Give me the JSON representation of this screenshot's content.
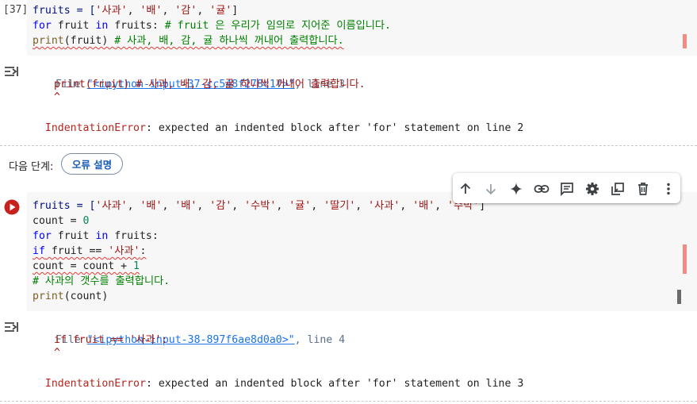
{
  "cell1": {
    "exec_count": "[37]",
    "code": [
      [
        [
          "fruits = [",
          "var"
        ],
        [
          "'사과'",
          "str"
        ],
        [
          ", ",
          ""
        ],
        [
          "'배'",
          "str"
        ],
        [
          ", ",
          ""
        ],
        [
          "'감'",
          "str"
        ],
        [
          ", ",
          ""
        ],
        [
          "'귤'",
          "str"
        ],
        [
          "]",
          ""
        ]
      ],
      [
        [
          "for",
          "kw"
        ],
        [
          " fruit ",
          ""
        ],
        [
          "in",
          "kw"
        ],
        [
          " fruits: ",
          ""
        ],
        [
          "# fruit 은 우리가 임의로 지어준 이름입니다.",
          "cm"
        ]
      ],
      [
        [
          "print",
          "fn"
        ],
        [
          "(fruit) ",
          ""
        ],
        [
          "# 사과, 배, 감, 귤 하나씩 꺼내어 출력합니다.",
          "cm"
        ]
      ]
    ],
    "output": {
      "file_prefix": "File ",
      "file_link": "\"<ipython-input-37-cc548f278c1f>\"",
      "line_info": ", line 3",
      "source_line": "print(fruit) # 사과, 배, 감, 귤 하나씩 꺼내어 출력합니다.",
      "caret": "^",
      "error_name": "IndentationError",
      "error_msg": ": expected an indented block after 'for' statement on line 2"
    }
  },
  "next_step": {
    "label": "다음 단계:",
    "button": "오류 설명"
  },
  "cell2": {
    "code": [
      [
        [
          "fruits = [",
          "var"
        ],
        [
          "'사과'",
          "str"
        ],
        [
          ", ",
          ""
        ],
        [
          "'배'",
          "str"
        ],
        [
          ", ",
          ""
        ],
        [
          "'배'",
          "str"
        ],
        [
          ", ",
          ""
        ],
        [
          "'감'",
          "str"
        ],
        [
          ", ",
          ""
        ],
        [
          "'수박'",
          "str"
        ],
        [
          ", ",
          ""
        ],
        [
          "'귤'",
          "str"
        ],
        [
          ", ",
          ""
        ],
        [
          "'딸기'",
          "str"
        ],
        [
          ", ",
          ""
        ],
        [
          "'사과'",
          "str"
        ],
        [
          ", ",
          ""
        ],
        [
          "'배'",
          "str"
        ],
        [
          ", ",
          ""
        ],
        [
          "'수박'",
          "str"
        ],
        [
          "]",
          ""
        ]
      ],
      [
        [
          "count = ",
          ""
        ],
        [
          "0",
          "num"
        ]
      ],
      [
        [
          "for",
          "kw"
        ],
        [
          " fruit ",
          ""
        ],
        [
          "in",
          "kw"
        ],
        [
          " fruits:",
          ""
        ]
      ],
      [
        [
          "if",
          "kw"
        ],
        [
          " fruit == ",
          ""
        ],
        [
          "'사과'",
          "str"
        ],
        [
          ":",
          ""
        ]
      ],
      [
        [
          "count = count + ",
          ""
        ],
        [
          "1",
          "num"
        ]
      ],
      [
        [
          "# 사과의 갯수를 출력합니다.",
          "cm"
        ]
      ],
      [
        [
          "print",
          "fn"
        ],
        [
          "(count)",
          ""
        ]
      ]
    ],
    "output": {
      "file_prefix": "File ",
      "file_link": "\"<ipython-input-38-897f6ae8d0a0>\"",
      "line_info": ", line 4",
      "source_line": "if fruit == '사과':",
      "caret": "^",
      "error_name": "IndentationError",
      "error_msg": ": expected an indented block after 'for' statement on line 3"
    }
  },
  "toolbar": {
    "buttons": [
      "move-up",
      "move-down",
      "gemini",
      "link",
      "comment",
      "settings",
      "mirror",
      "delete",
      "more"
    ]
  },
  "colors": {
    "accent": "#1a73e8",
    "error_red": "#b3261e",
    "run_red": "#c5221f"
  }
}
